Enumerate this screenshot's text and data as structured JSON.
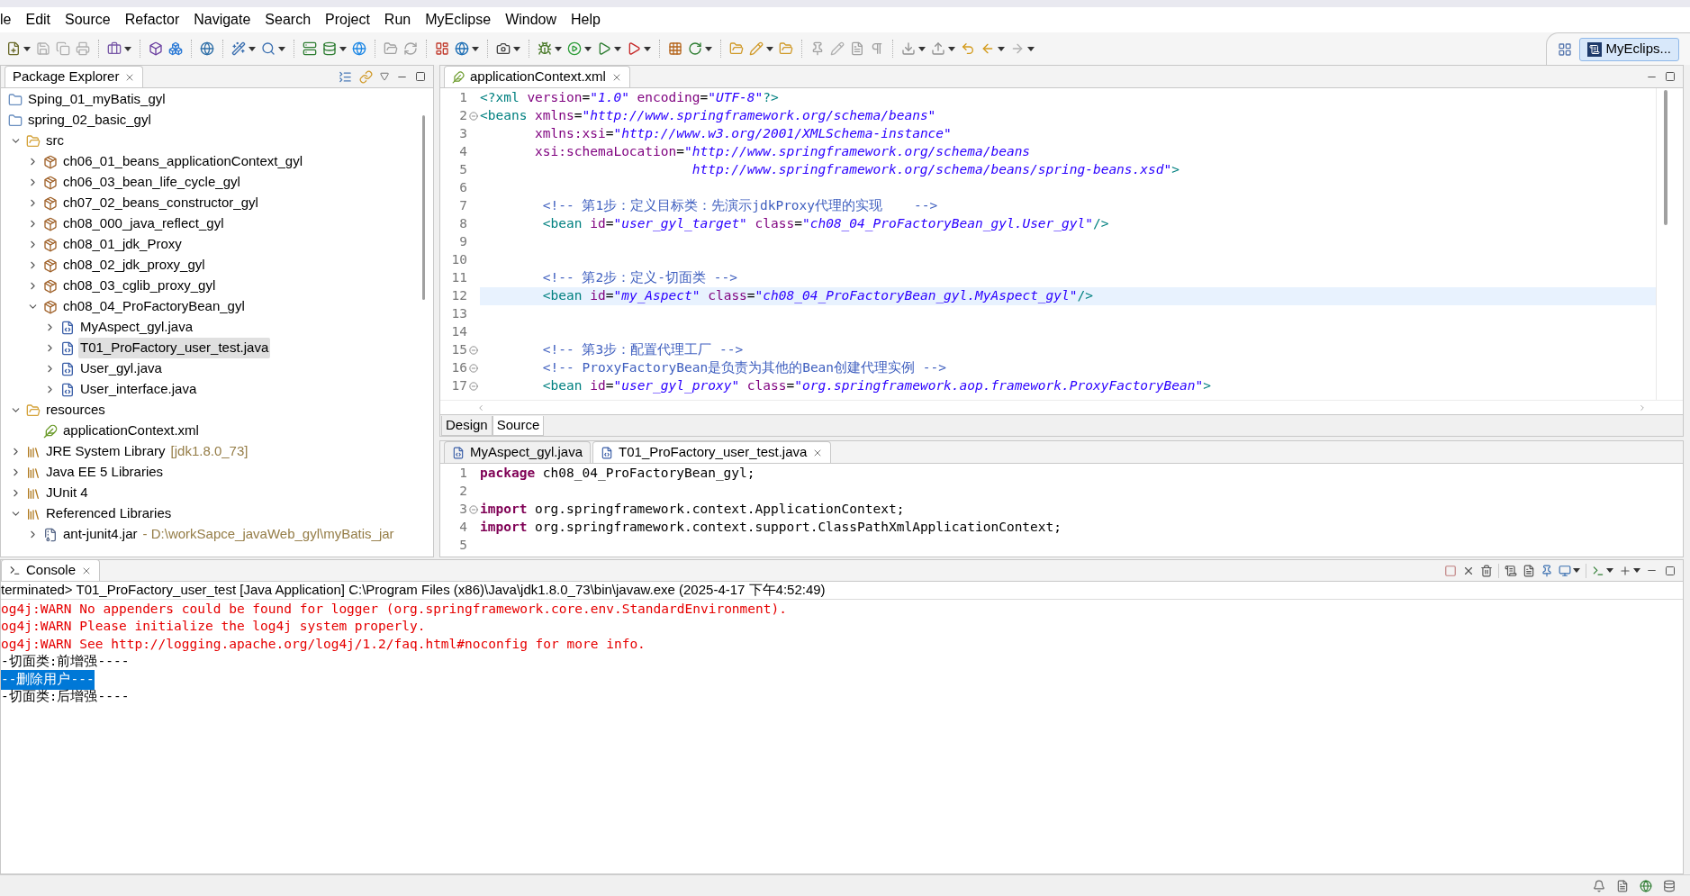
{
  "menu": [
    "le",
    "Edit",
    "Source",
    "Refactor",
    "Navigate",
    "Search",
    "Project",
    "Run",
    "MyEclipse",
    "Window",
    "Help"
  ],
  "perspective": {
    "label": "MyEclips..."
  },
  "package_explorer": {
    "title": "Package Explorer",
    "tree": [
      {
        "label": "Sping_01_myBatis_gyl",
        "kind": "project",
        "selected": false
      },
      {
        "label": "spring_02_basic_gyl",
        "kind": "project",
        "selected": false,
        "children": [
          {
            "label": "src",
            "kind": "folder",
            "expanded": true,
            "selected": false,
            "children": [
              {
                "label": "ch06_01_beans_applicationContext_gyl",
                "kind": "package",
                "expanded": false,
                "selected": false
              },
              {
                "label": "ch06_03_bean_life_cycle_gyl",
                "kind": "package",
                "expanded": false,
                "selected": false
              },
              {
                "label": "ch07_02_beans_constructor_gyl",
                "kind": "package",
                "expanded": false,
                "selected": false
              },
              {
                "label": "ch08_000_java_reflect_gyl",
                "kind": "package",
                "expanded": false,
                "selected": false
              },
              {
                "label": "ch08_01_jdk_Proxy",
                "kind": "package",
                "expanded": false,
                "selected": false
              },
              {
                "label": "ch08_02_jdk_proxy_gyl",
                "kind": "package",
                "expanded": false,
                "selected": false
              },
              {
                "label": "ch08_03_cglib_proxy_gyl",
                "kind": "package",
                "expanded": false,
                "selected": false
              },
              {
                "label": "ch08_04_ProFactoryBean_gyl",
                "kind": "package",
                "expanded": true,
                "selected": false,
                "children": [
                  {
                    "label": "MyAspect_gyl.java",
                    "kind": "java",
                    "expanded": false,
                    "selected": false
                  },
                  {
                    "label": "T01_ProFactory_user_test.java",
                    "kind": "java",
                    "expanded": false,
                    "selected": true
                  },
                  {
                    "label": "User_gyl.java",
                    "kind": "java",
                    "expanded": false,
                    "selected": false
                  },
                  {
                    "label": "User_interface.java",
                    "kind": "java",
                    "expanded": false,
                    "selected": false
                  }
                ]
              }
            ]
          },
          {
            "label": "resources",
            "kind": "folder",
            "expanded": true,
            "selected": false,
            "children": [
              {
                "label": "applicationContext.xml",
                "kind": "xml",
                "selected": false
              }
            ]
          },
          {
            "label": "JRE System Library",
            "decoration": "[jdk1.8.0_73]",
            "kind": "library",
            "expanded": false,
            "selected": false
          },
          {
            "label": "Java EE 5 Libraries",
            "kind": "library",
            "expanded": false,
            "selected": false
          },
          {
            "label": "JUnit 4",
            "kind": "library",
            "expanded": false,
            "selected": false
          },
          {
            "label": "Referenced Libraries",
            "kind": "library",
            "expanded": true,
            "selected": false,
            "children": [
              {
                "label": "ant-junit4.jar",
                "decoration": "- D:\\workSapce_javaWeb_gyl\\myBatis_jar",
                "kind": "jar",
                "expanded": false,
                "selected": false
              }
            ]
          }
        ]
      }
    ]
  },
  "editor_top": {
    "tab": "applicationContext.xml",
    "lines": [
      {
        "n": "1",
        "fold": false,
        "current": false,
        "tokens": [
          {
            "kind": "tag",
            "t": "<?xml"
          },
          {
            "kind": "attr",
            "t": " version"
          },
          {
            "kind": "plain",
            "t": "="
          },
          {
            "kind": "str",
            "t": "\"1.0\""
          },
          {
            "kind": "attr",
            "t": " encoding"
          },
          {
            "kind": "plain",
            "t": "="
          },
          {
            "kind": "str",
            "t": "\"UTF-8\""
          },
          {
            "kind": "tag",
            "t": "?>"
          }
        ]
      },
      {
        "n": "2",
        "fold": true,
        "current": false,
        "tokens": [
          {
            "kind": "tag",
            "t": "<beans"
          },
          {
            "kind": "attr",
            "t": " xmlns"
          },
          {
            "kind": "plain",
            "t": "="
          },
          {
            "kind": "str",
            "t": "\"http://www.springframework.org/schema/beans\""
          }
        ]
      },
      {
        "n": "3",
        "fold": false,
        "current": false,
        "tokens": [
          {
            "kind": "attr",
            "t": "       xmlns:xsi"
          },
          {
            "kind": "plain",
            "t": "="
          },
          {
            "kind": "str",
            "t": "\"http://www.w3.org/2001/XMLSchema-instance\""
          }
        ]
      },
      {
        "n": "4",
        "fold": false,
        "current": false,
        "tokens": [
          {
            "kind": "attr",
            "t": "       xsi:schemaLocation"
          },
          {
            "kind": "plain",
            "t": "="
          },
          {
            "kind": "str",
            "t": "\"http://www.springframework.org/schema/beans"
          }
        ]
      },
      {
        "n": "5",
        "fold": false,
        "current": false,
        "tokens": [
          {
            "kind": "str",
            "t": "                           http://www.springframework.org/schema/beans/spring-beans.xsd\""
          },
          {
            "kind": "tag",
            "t": ">"
          }
        ]
      },
      {
        "n": "6",
        "fold": false,
        "current": false
      },
      {
        "n": "7",
        "fold": false,
        "current": false,
        "tokens": [
          {
            "kind": "comment",
            "t": "        <!-- 第1步：定义目标类：先演示jdkProxy代理的实现    -->"
          }
        ]
      },
      {
        "n": "8",
        "fold": false,
        "current": false,
        "tokens": [
          {
            "kind": "tag",
            "t": "        <bean"
          },
          {
            "kind": "attr",
            "t": " id"
          },
          {
            "kind": "plain",
            "t": "="
          },
          {
            "kind": "str",
            "t": "\"user_gyl_target\""
          },
          {
            "kind": "attr",
            "t": " class"
          },
          {
            "kind": "plain",
            "t": "="
          },
          {
            "kind": "str",
            "t": "\"ch08_04_ProFactoryBean_gyl.User_gyl\""
          },
          {
            "kind": "tag",
            "t": "/>"
          }
        ]
      },
      {
        "n": "9",
        "fold": false,
        "current": false
      },
      {
        "n": "10",
        "fold": false,
        "current": false
      },
      {
        "n": "11",
        "fold": false,
        "current": false,
        "tokens": [
          {
            "kind": "comment",
            "t": "        <!-- 第2步：定义-切面类 -->"
          }
        ]
      },
      {
        "n": "12",
        "fold": false,
        "current": true,
        "tokens": [
          {
            "kind": "tag",
            "t": "        <bean"
          },
          {
            "kind": "attr",
            "t": " id"
          },
          {
            "kind": "plain",
            "t": "="
          },
          {
            "kind": "str",
            "t": "\"my_Aspect\""
          },
          {
            "kind": "attr",
            "t": " class"
          },
          {
            "kind": "plain",
            "t": "="
          },
          {
            "kind": "str",
            "t": "\"ch08_04_ProFactoryBean_gyl.MyAspect_gyl\""
          },
          {
            "kind": "tag",
            "t": "/>"
          }
        ]
      },
      {
        "n": "13",
        "fold": false,
        "current": false
      },
      {
        "n": "14",
        "fold": false,
        "current": false
      },
      {
        "n": "15",
        "fold": true,
        "current": false,
        "tokens": [
          {
            "kind": "comment",
            "t": "        <!-- 第3步：配置代理工厂 -->"
          }
        ]
      },
      {
        "n": "16",
        "fold": true,
        "current": false,
        "tokens": [
          {
            "kind": "comment",
            "t": "        <!-- ProxyFactoryBean是负责为其他的Bean创建代理实例 -->"
          }
        ]
      },
      {
        "n": "17",
        "fold": true,
        "current": false,
        "tokens": [
          {
            "kind": "tag",
            "t": "        <bean"
          },
          {
            "kind": "attr",
            "t": " id"
          },
          {
            "kind": "plain",
            "t": "="
          },
          {
            "kind": "str",
            "t": "\"user_gyl_proxy\""
          },
          {
            "kind": "attr",
            "t": " class"
          },
          {
            "kind": "plain",
            "t": "="
          },
          {
            "kind": "str",
            "t": "\"org.springframework.aop.framework.ProxyFactoryBean\""
          },
          {
            "kind": "tag",
            "t": ">"
          }
        ]
      }
    ],
    "bottom_tabs": [
      {
        "label": "Design",
        "selected": false
      },
      {
        "label": "Source",
        "selected": true
      }
    ]
  },
  "editor_bottom": {
    "tabs": [
      {
        "label": "MyAspect_gyl.java",
        "selected": false
      },
      {
        "label": "T01_ProFactory_user_test.java",
        "selected": true
      }
    ],
    "lines": [
      {
        "n": "1",
        "fold": false,
        "tokens": [
          {
            "kind": "keyword",
            "t": "package"
          },
          {
            "kind": "plain",
            "t": " ch08_04_ProFactoryBean_gyl;"
          }
        ]
      },
      {
        "n": "2",
        "fold": false
      },
      {
        "n": "3",
        "fold": true,
        "tokens": [
          {
            "kind": "keyword",
            "t": "import"
          },
          {
            "kind": "plain",
            "t": " org.springframework.context.ApplicationContext;"
          }
        ]
      },
      {
        "n": "4",
        "fold": false,
        "tokens": [
          {
            "kind": "keyword",
            "t": "import"
          },
          {
            "kind": "plain",
            "t": " org.springframework.context.support.ClassPathXmlApplicationContext;"
          }
        ]
      },
      {
        "n": "5",
        "fold": false
      }
    ]
  },
  "console": {
    "title": "Console",
    "header": "terminated> T01_ProFactory_user_test [Java Application] C:\\Program Files (x86)\\Java\\jdk1.8.0_73\\bin\\javaw.exe (2025-4-17 下午4:52:49)",
    "lines": [
      {
        "text": "og4j:WARN No appenders could be found for logger (org.springframework.core.env.StandardEnvironment).",
        "kind": "error",
        "selected": false
      },
      {
        "text": "og4j:WARN Please initialize the log4j system properly.",
        "kind": "error",
        "selected": false
      },
      {
        "text": "og4j:WARN See http://logging.apache.org/log4j/1.2/faq.html#noconfig for more info.",
        "kind": "error",
        "selected": false
      },
      {
        "text": "-切面类:前增强----",
        "kind": "output",
        "selected": false
      },
      {
        "text": "--删除用户---",
        "kind": "output",
        "selected": true
      },
      {
        "text": "-切面类:后增强----",
        "kind": "output",
        "selected": false
      }
    ]
  }
}
